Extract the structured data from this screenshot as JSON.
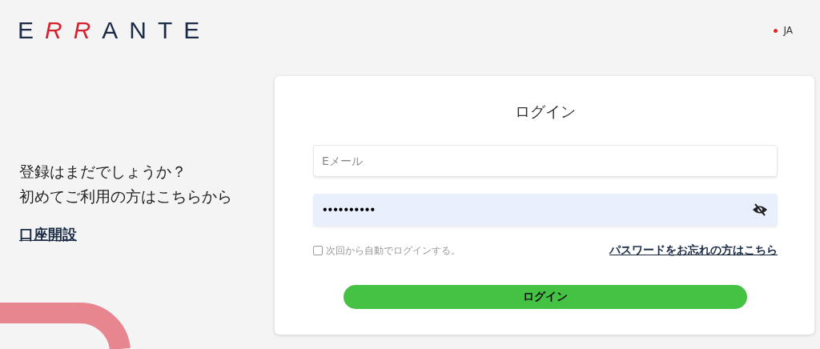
{
  "header": {
    "logo": [
      {
        "text": "E",
        "accent": false
      },
      {
        "text": "RR",
        "accent": true
      },
      {
        "text": "ANTE",
        "accent": false
      }
    ],
    "language": {
      "label": "JA"
    }
  },
  "promo": {
    "lines": [
      "登録はまだでしょうか？",
      "初めてご利用の方はこちらから"
    ],
    "link": "口座開設"
  },
  "login": {
    "title": "ログイン",
    "email": {
      "placeholder": "Eメール"
    },
    "password": {
      "value": "••••••••••",
      "masked": true
    },
    "remember": {
      "label": "次回から自動でログインする。",
      "checked": false
    },
    "forgot_link": "パスワードをお忘れの方はこちら",
    "submit": "ログイン"
  }
}
